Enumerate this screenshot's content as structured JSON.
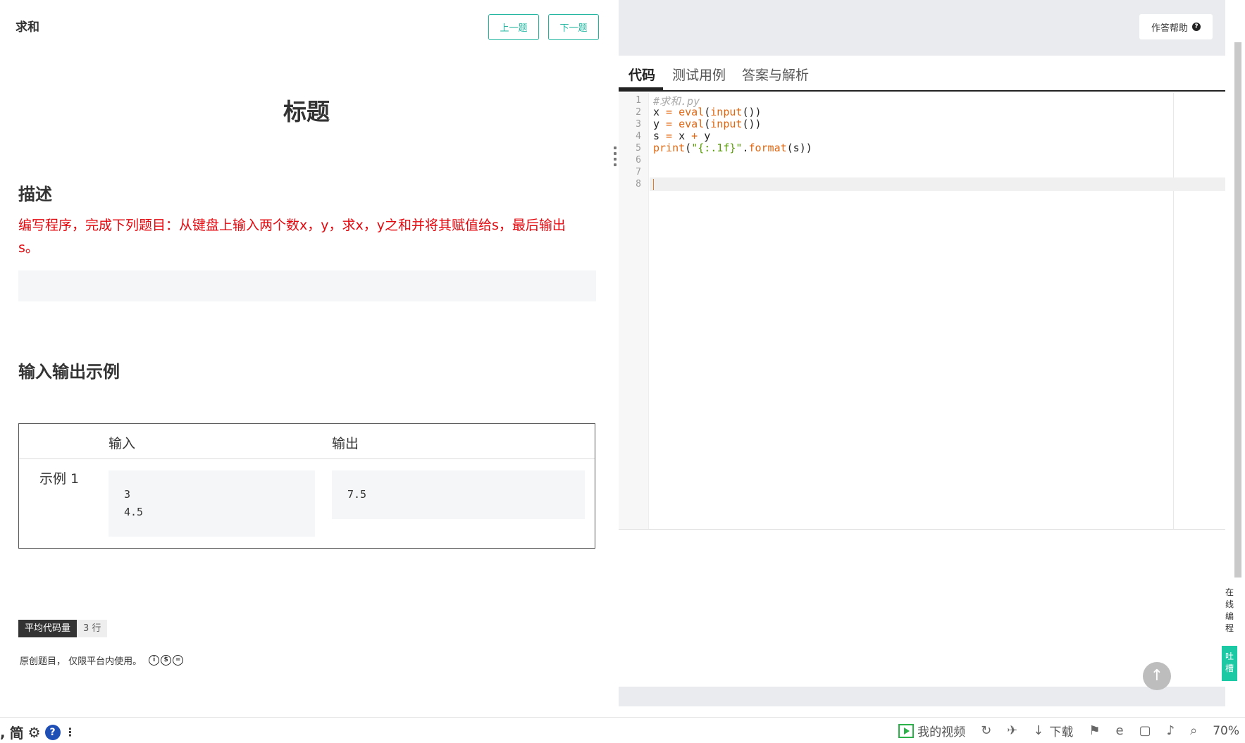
{
  "problem": {
    "name": "求和",
    "prev_label": "上一题",
    "next_label": "下一题",
    "title": "标题",
    "description_heading": "描述",
    "description_text": "编写程序，完成下列题目：从键盘上输入两个数x，y，求x，y之和并将其赋值给s，最后输出s。",
    "io_heading": "输入输出示例",
    "io_table": {
      "col_input": "输入",
      "col_output": "输出",
      "rows": [
        {
          "label": "示例 1",
          "input_line1": "3",
          "input_line2": "4.5",
          "output": "7.5"
        }
      ]
    },
    "stat_label": "平均代码量",
    "stat_value": "3 行",
    "license_text": "原创题目， 仅限平台内使用。"
  },
  "editor": {
    "help_label": "作答帮助",
    "tabs": [
      "代码",
      "测试用例",
      "答案与解析"
    ],
    "active_tab": 0,
    "line_numbers": [
      "1",
      "2",
      "3",
      "4",
      "5",
      "6",
      "7",
      "8"
    ],
    "code": {
      "l1": "#求和.py",
      "l2_a": "x",
      "l2_b": " = ",
      "l2_c": "eval",
      "l2_d": "(",
      "l2_e": "input",
      "l2_f": "())",
      "l3_a": "y",
      "l3_b": " = ",
      "l3_c": "eval",
      "l3_d": "(",
      "l3_e": "input",
      "l3_f": "())",
      "l4_a": "s",
      "l4_b": " = ",
      "l4_c": "x",
      "l4_d": " + ",
      "l4_e": "y",
      "l5_a": "print",
      "l5_b": "(",
      "l5_c": "\"{:.1f}\"",
      "l5_d": ".",
      "l5_e": "format",
      "l5_f": "(s))"
    }
  },
  "side": {
    "online_label": "在线编程",
    "feedback_label": "吐槽"
  },
  "statusbar": {
    "left_simplified": "简",
    "my_video": "我的视频",
    "download": "下载",
    "zoom": "70%"
  }
}
